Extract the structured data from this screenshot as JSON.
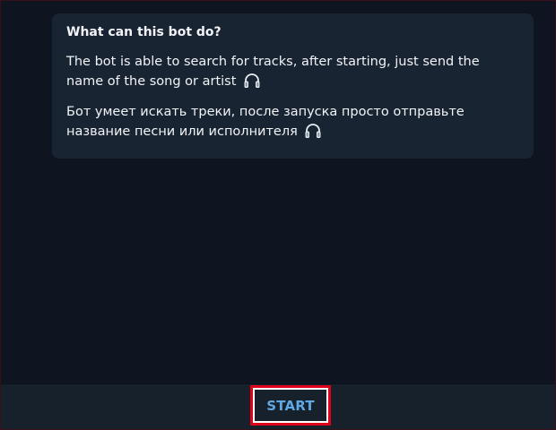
{
  "bot_info": {
    "title": "What can this bot do?",
    "description_en": "The bot is able to search for tracks, after starting, just send the name of the song or artist",
    "description_ru": "Бот умеет искать треки, после запуска просто отправьте название песни или исполнителя",
    "icon": "headphones-icon"
  },
  "bottom_bar": {
    "start_label": "START"
  },
  "colors": {
    "background": "#0e1520",
    "card": "#192432",
    "bottom_bar": "#17212b",
    "accent": "#5fa8e6",
    "highlight": "#e0001a"
  }
}
